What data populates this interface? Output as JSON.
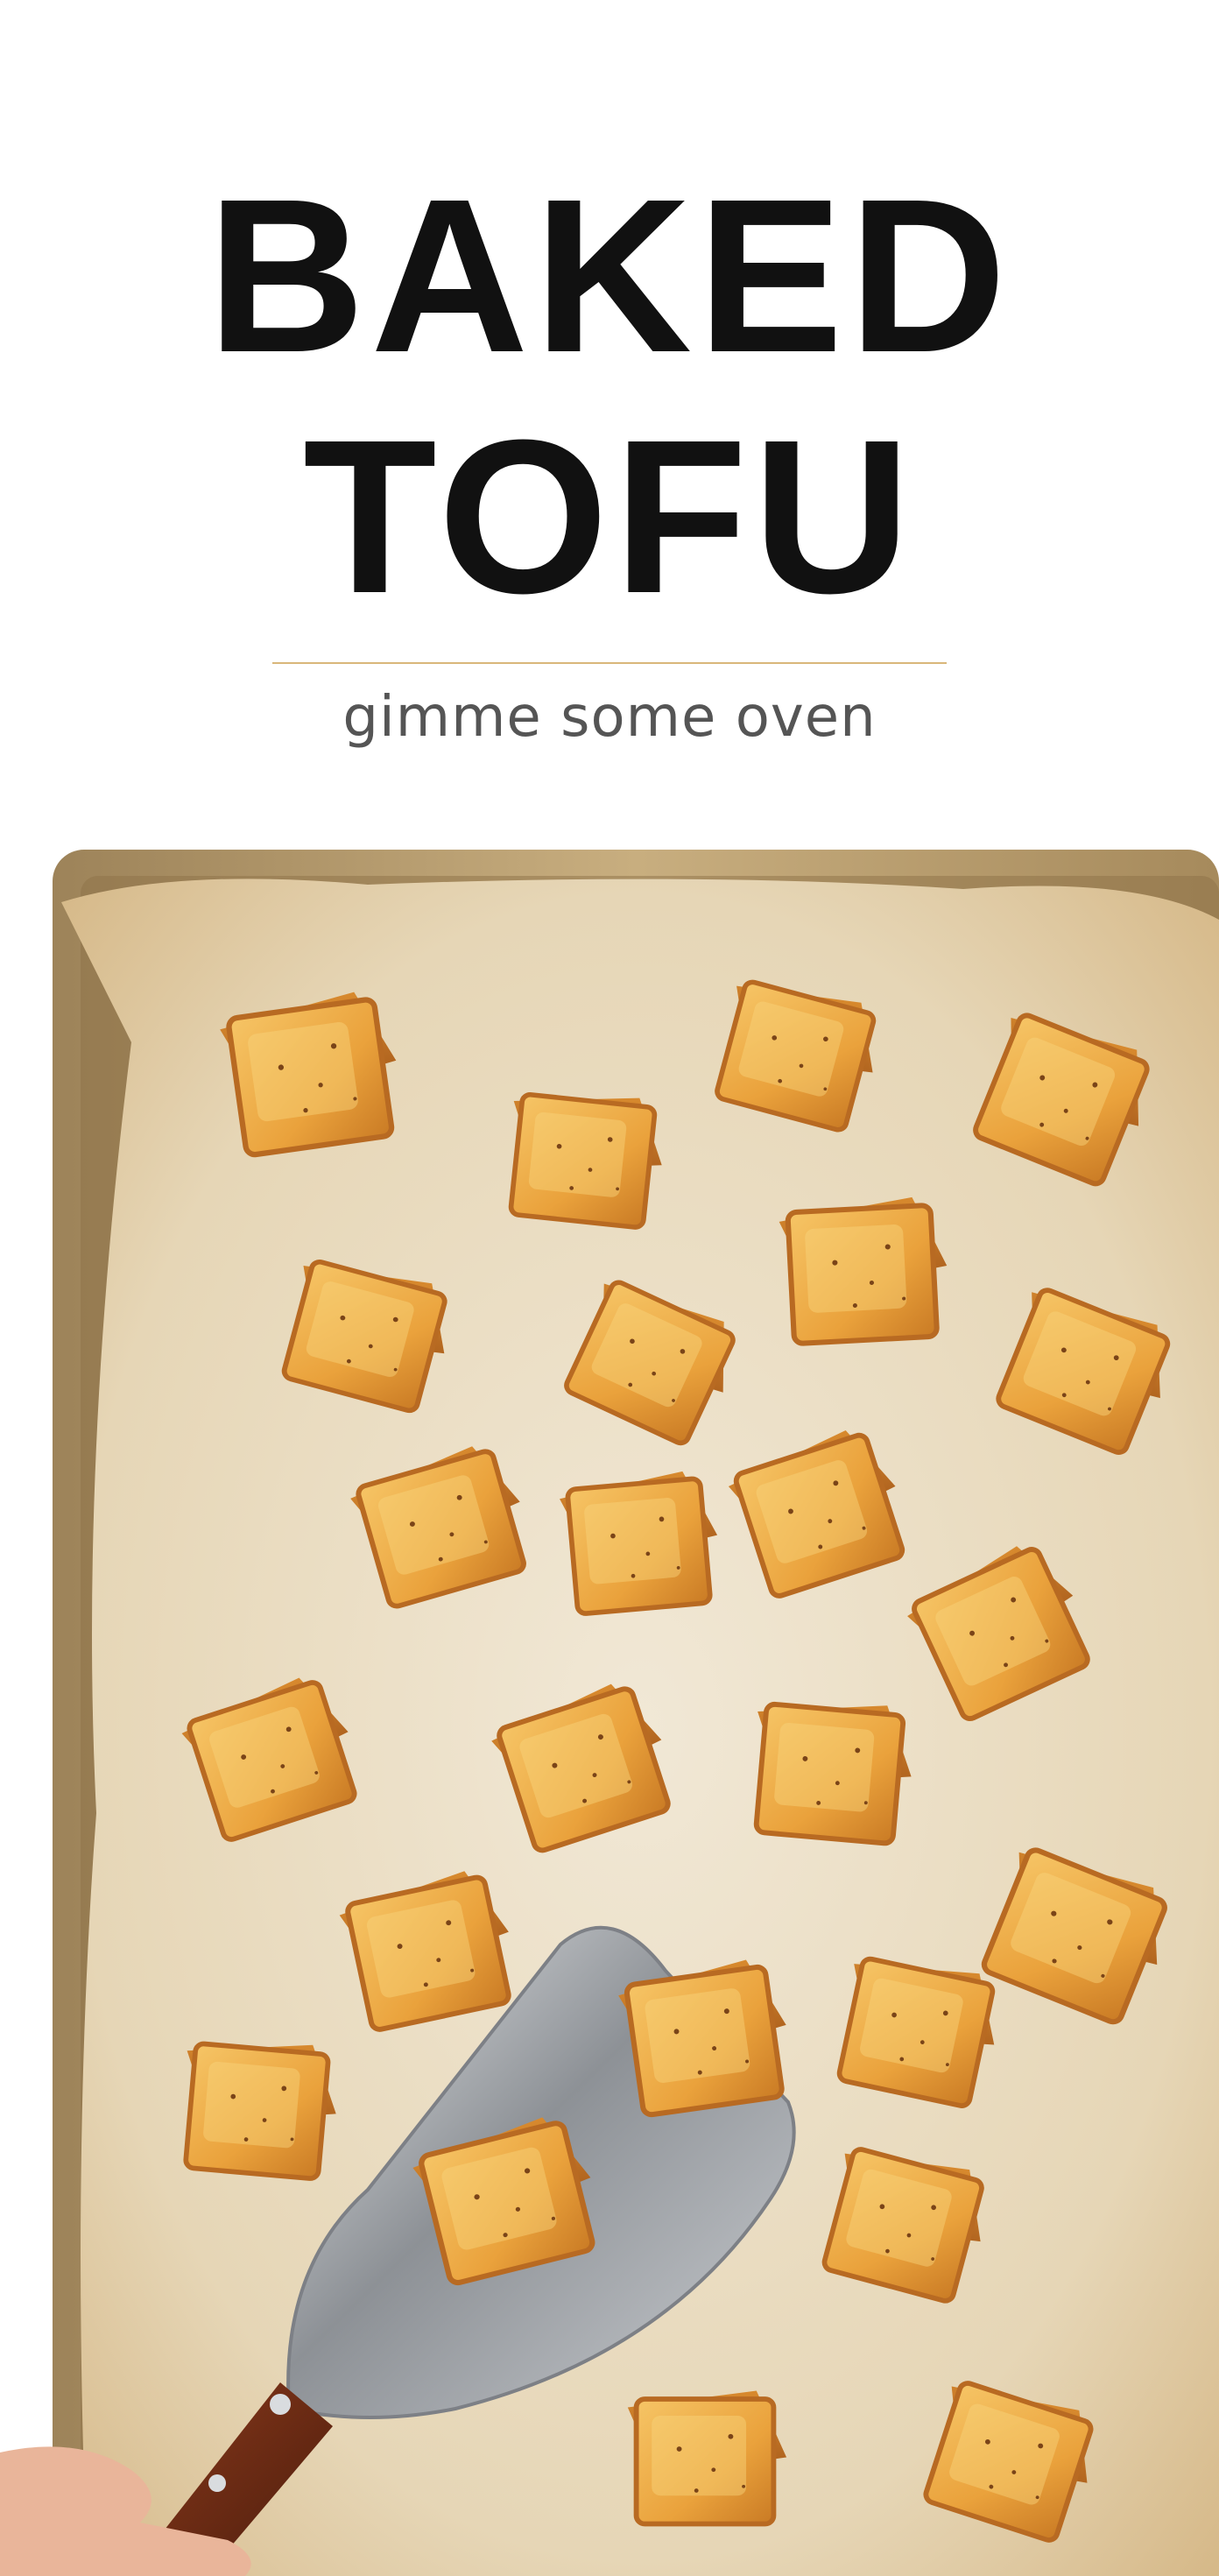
{
  "header": {
    "title_line1": "BAKED",
    "title_line2": "TOFU",
    "brand": "gimme some oven"
  },
  "colors": {
    "title": "#111111",
    "divider": "#d9b77a",
    "brand": "#555555",
    "tray": "#b59a6c",
    "parchment": "#e8dcc4",
    "tofu": "#e8a33b"
  }
}
